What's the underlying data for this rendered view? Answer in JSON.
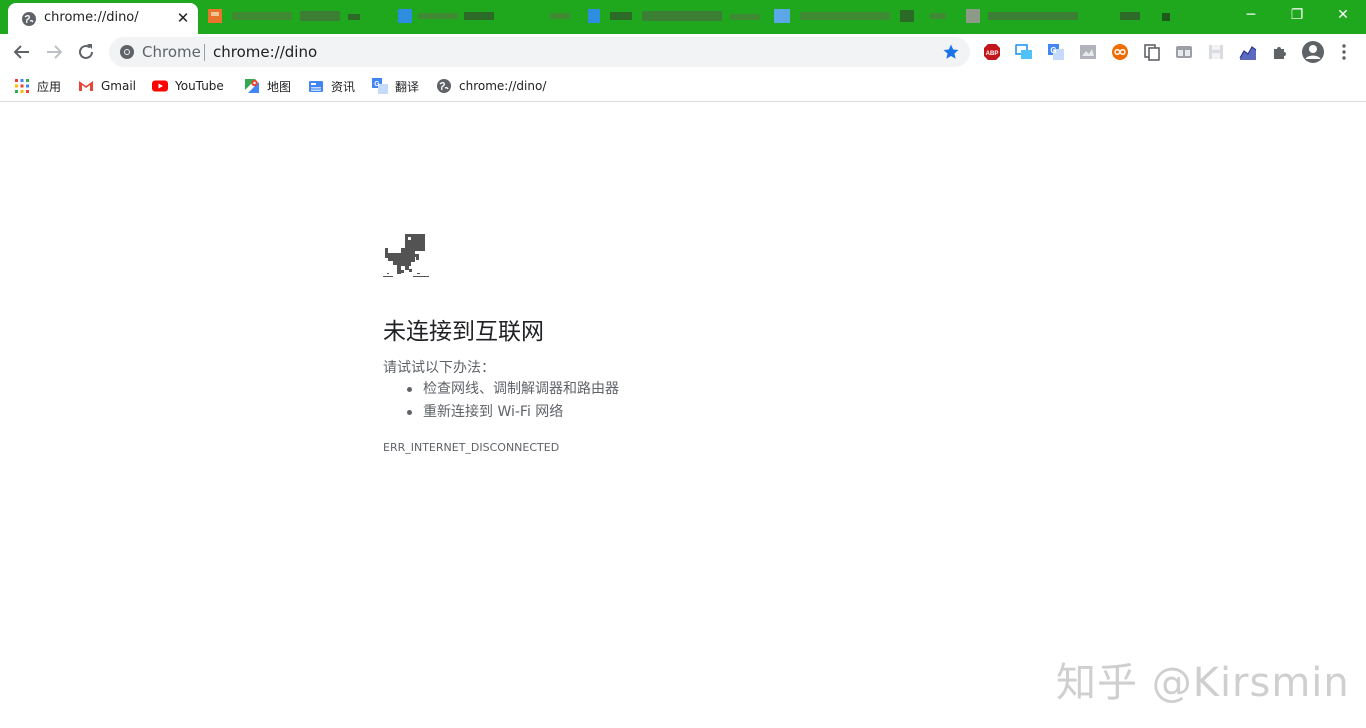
{
  "tabs": {
    "active": {
      "title": "chrome://dino/",
      "close_icon": "close-icon"
    }
  },
  "window_controls": {
    "minimize": "─",
    "restore": "❐",
    "close": "✕"
  },
  "omnibox": {
    "chip_label": "Chrome",
    "url": "chrome://dino",
    "bookmarked": true
  },
  "bookmarks": [
    {
      "label": "应用",
      "icon": "apps-grid-icon"
    },
    {
      "label": "Gmail",
      "icon": "gmail-icon"
    },
    {
      "label": "YouTube",
      "icon": "youtube-icon"
    },
    {
      "label": "地图",
      "icon": "maps-icon"
    },
    {
      "label": "资讯",
      "icon": "news-icon"
    },
    {
      "label": "翻译",
      "icon": "translate-icon"
    },
    {
      "label": "chrome://dino/",
      "icon": "globe-icon"
    }
  ],
  "extensions": [
    "adblock-plus-icon",
    "screen-share-icon",
    "google-translate-icon",
    "image-tool-icon",
    "infinity-icon",
    "copy-tool-icon",
    "tab-tool-icon",
    "save-tool-icon",
    "chart-tool-icon",
    "puzzle-extensions-icon",
    "profile-avatar-icon",
    "menu-kebab-icon"
  ],
  "colors": {
    "frame": "#1fa81d",
    "star": "#1a73e8",
    "text_secondary": "#5f6368"
  },
  "error": {
    "title": "未连接到互联网",
    "intro": "请试试以下办法：",
    "suggestions": [
      "检查网线、调制解调器和路由器",
      "重新连接到 Wi-Fi 网络"
    ],
    "code": "ERR_INTERNET_DISCONNECTED"
  },
  "watermark": "知乎 @Kirsmin"
}
